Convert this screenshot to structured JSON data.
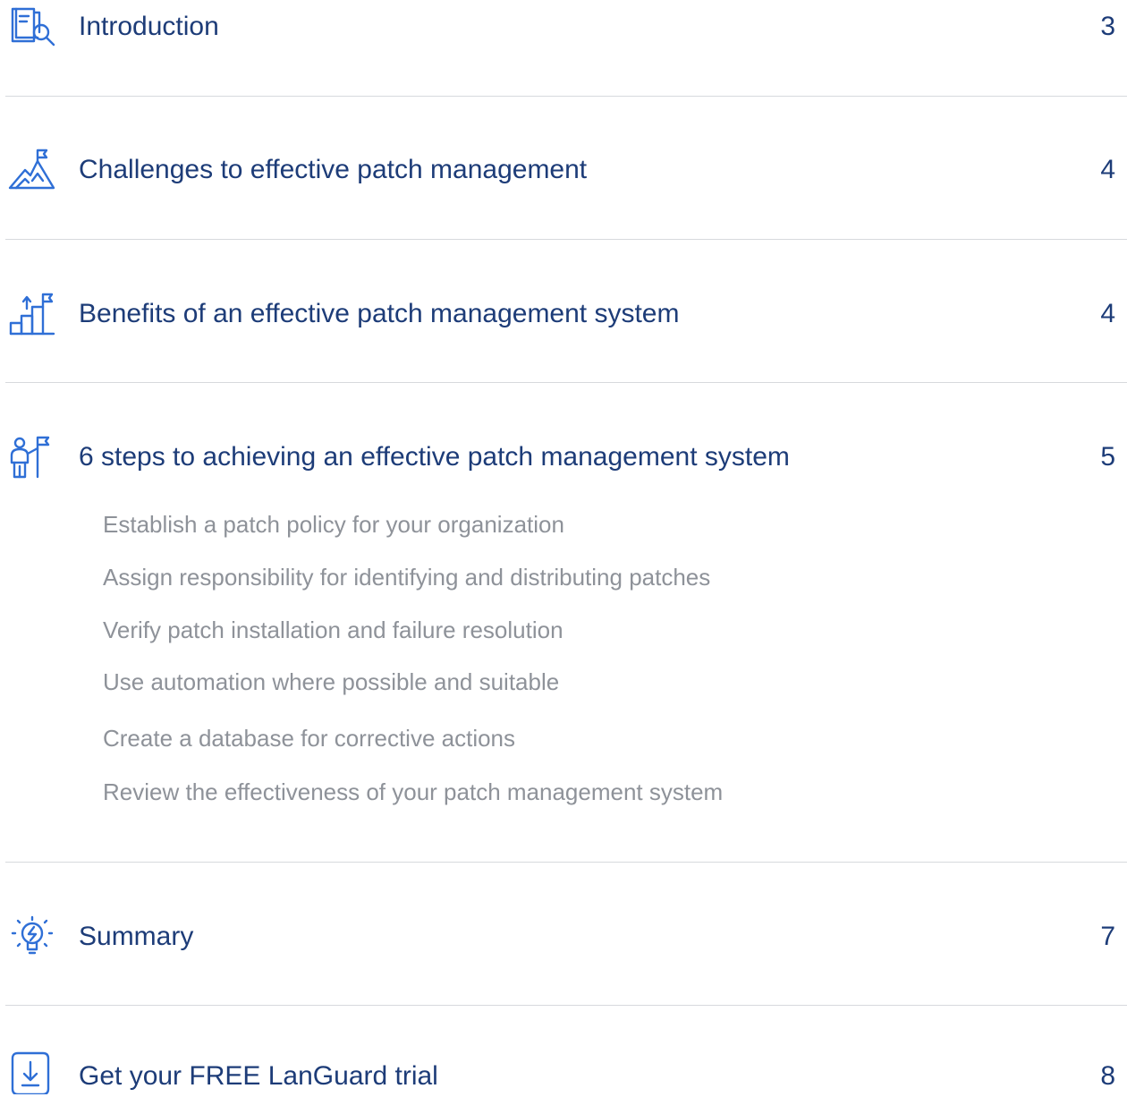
{
  "colors": {
    "title": "#1d3c78",
    "icon": "#2f6fd6",
    "subitem": "#8e9299",
    "divider": "#d7d9dd"
  },
  "entries": [
    {
      "icon": "document-search-icon",
      "title": "Introduction",
      "page": "3"
    },
    {
      "icon": "mountain-flag-icon",
      "title": "Challenges to effective patch management",
      "page": "4"
    },
    {
      "icon": "growth-steps-flag-icon",
      "title": "Benefits of an effective patch management system",
      "page": "4"
    },
    {
      "icon": "person-flag-icon",
      "title": "6 steps to achieving an effective patch management system",
      "page": "5"
    },
    {
      "icon": "lightbulb-idea-icon",
      "title": "Summary",
      "page": "7"
    },
    {
      "icon": "download-file-icon",
      "title_before": "Get your ",
      "title_emphasis": "FREE",
      "title_after": " LanGuard trial",
      "page": "8"
    }
  ],
  "subitems": [
    "Establish a patch policy for your organization",
    "Assign responsibility for identifying and distributing patches",
    "Verify patch installation and failure resolution",
    "Use automation where possible and suitable",
    "Create a database for corrective actions",
    "Review the effectiveness of your patch management system"
  ]
}
